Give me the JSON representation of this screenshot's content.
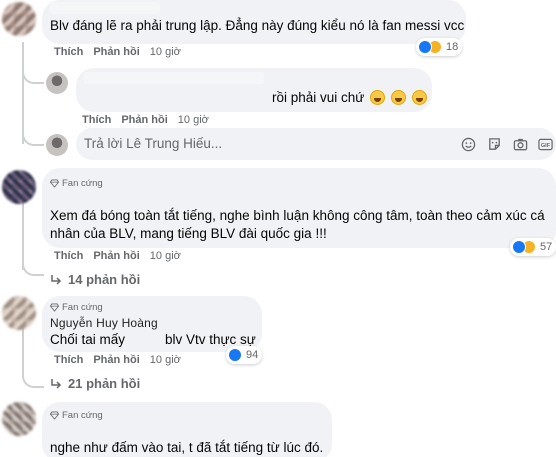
{
  "colors": {
    "bubble_bg": "#f0f2f5",
    "muted_text": "#65676b",
    "like_blue": "#1877f2",
    "haha_yellow": "#f7b125"
  },
  "comments": [
    {
      "text": "Blv đáng lẽ ra phải trung lập. Đẳng này đúng kiểu nó là fan messi vcc",
      "actions": {
        "like": "Thích",
        "reply": "Phản hồi",
        "time": "10 giờ"
      },
      "reactions": {
        "icons": [
          "like-icon",
          "haha-icon"
        ],
        "count": "18"
      }
    },
    {
      "text": "rồi phải vui chứ",
      "actions": {
        "like": "Thích",
        "reply": "Phản hồi",
        "time": "10 giờ"
      }
    },
    {
      "badge": "Fan cứng",
      "text_line1": "Xem đá bóng toàn tắt tiếng, nghe bình luận không công tâm, toàn theo cảm xúc cá",
      "text_line2": "nhân của BLV, mang tiếng BLV đài quốc gia !!!",
      "actions": {
        "like": "Thích",
        "reply": "Phản hồi",
        "time": "10 giờ"
      },
      "reactions": {
        "icons": [
          "like-icon",
          "haha-icon"
        ],
        "count": "57"
      },
      "replies": "14 phản hồi"
    },
    {
      "badge": "Fan cứng",
      "author": "Nguyễn Huy Hoàng",
      "text_a": "Chối tai mấy",
      "text_b": "blv Vtv thực sự",
      "actions": {
        "like": "Thích",
        "reply": "Phản hồi",
        "time": "10 giờ"
      },
      "reactions": {
        "icons": [
          "like-icon"
        ],
        "count": "94"
      },
      "replies": "21 phản hồi"
    },
    {
      "badge": "Fan cứng",
      "text": "nghe như đấm vào tai, t đã tắt tiếng từ lúc đó."
    }
  ],
  "reply_box": {
    "placeholder": "Trả lời Lê Trung Hiếu...",
    "tools": [
      "emoji-icon",
      "sticker-icon",
      "camera-icon",
      "gif-icon"
    ],
    "gif_label": "GIF"
  }
}
